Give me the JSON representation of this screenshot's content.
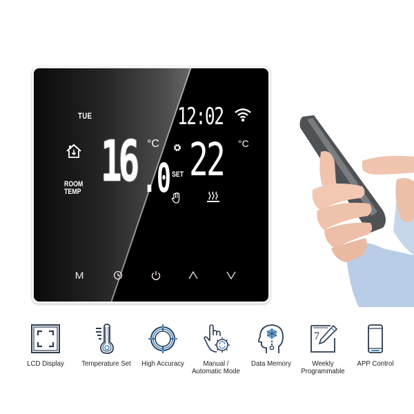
{
  "thermostat": {
    "display": {
      "day": "TUE",
      "time": "12:02",
      "room_temp_label_line1": "ROOM",
      "room_temp_label_line2": "TEMP",
      "room_temp_integer": "16",
      "room_temp_decimal": ".0",
      "room_temp_unit": "°C",
      "set_label": "SET",
      "set_temp": "22",
      "set_temp_unit": "°C",
      "icons": [
        "home-icon",
        "wifi-icon",
        "gear-icon",
        "manual-hand-icon",
        "heating-icon"
      ]
    },
    "buttons": [
      {
        "name": "mode",
        "label": "M",
        "icon": "mode-icon"
      },
      {
        "name": "clock",
        "label": "",
        "icon": "clock-icon"
      },
      {
        "name": "power",
        "label": "",
        "icon": "power-icon"
      },
      {
        "name": "up",
        "label": "",
        "icon": "chevron-up-icon"
      },
      {
        "name": "down",
        "label": "",
        "icon": "chevron-down-icon"
      }
    ],
    "colors": {
      "panel": "#000000",
      "text": "#ffffff",
      "frame": "#f4f4f4"
    }
  },
  "features": [
    {
      "icon": "lcd-display-icon",
      "line1": "LCD Display",
      "line2": ""
    },
    {
      "icon": "thermometer-icon",
      "line1": "Temperature Set",
      "line2": ""
    },
    {
      "icon": "crosshair-icon",
      "line1": "High Accuracy",
      "line2": ""
    },
    {
      "icon": "manual-auto-icon",
      "line1": "Manual /",
      "line2": "Automatic Mode"
    },
    {
      "icon": "brain-memory-icon",
      "line1": "Data Memory",
      "line2": ""
    },
    {
      "icon": "calendar-pen-icon",
      "line1": "Weekly",
      "line2": "Programmable"
    },
    {
      "icon": "smartphone-icon",
      "line1": "APP Control",
      "line2": ""
    }
  ],
  "feature_colors": {
    "outline": "#2a3a4f",
    "accent": "#3a8ad0"
  }
}
